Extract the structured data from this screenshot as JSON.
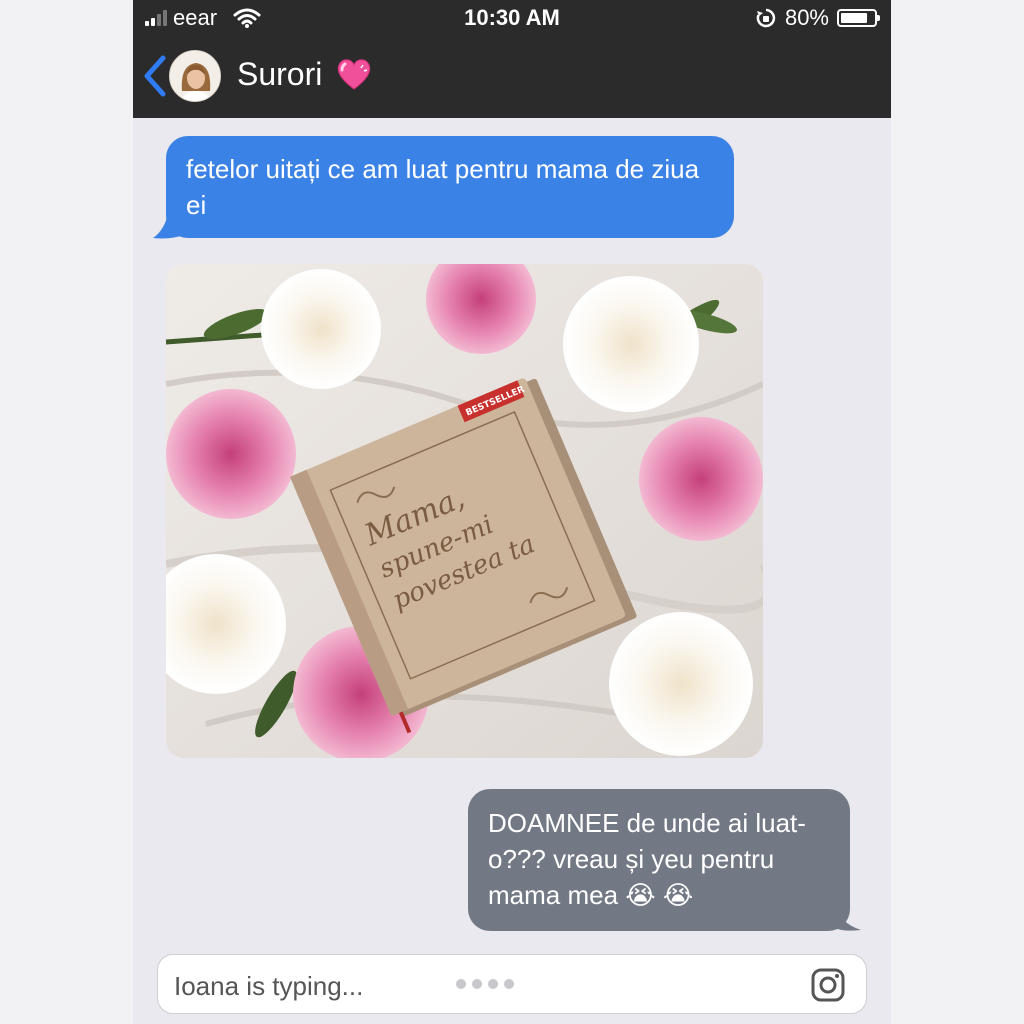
{
  "status_bar": {
    "carrier": "eear",
    "time": "10:30 AM",
    "battery": "80%",
    "battery_level": 0.8
  },
  "header": {
    "contact_name": "Surori",
    "contact_emoji": "pink-heart-icon",
    "back_icon": "chevron-left-icon"
  },
  "messages": [
    {
      "direction": "incoming",
      "text": "fetelor uitați ce am luat pentru mama de ziua ei"
    },
    {
      "direction": "incoming",
      "type": "image",
      "book_title_lines": [
        "Mama,",
        "spune-mi",
        "povestea ta"
      ],
      "book_ribbon": "BESTSELLER"
    },
    {
      "direction": "outgoing",
      "text": "DOAMNEE de unde ai luat-o??? vreau și yeu pentru mama mea",
      "emojis": "😭 😭"
    }
  ],
  "input_bar": {
    "typing_text": "Ioana is typing...",
    "camera_icon": "camera-icon"
  },
  "colors": {
    "incoming_bubble": "#3b82e6",
    "outgoing_bubble": "#727985",
    "header_bg": "#2b2b2b",
    "chat_bg": "#e9e9ef"
  }
}
